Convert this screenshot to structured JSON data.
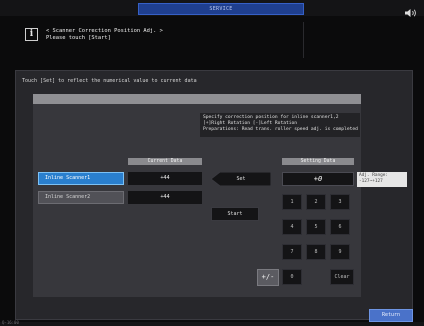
{
  "header": {
    "mode_tab": "SERVICE",
    "message_line1": "< Scanner Correction Position Adj. >",
    "message_line2": "Please touch [Start]"
  },
  "panel": {
    "instruction": "Touch [Set] to reflect the numerical value to current data",
    "description": [
      "Specify correction position for inline scanner1,2",
      "[+]Right Rotation  [-]Left Rotation",
      "Preparations: Read trans. roller speed adj. is completed"
    ],
    "current_data_header": "Current Data",
    "setting_data_header": "Setting Data",
    "scanners": [
      {
        "label": "Inline Scanner1",
        "current": "+44",
        "selected": true
      },
      {
        "label": "Inline Scanner2",
        "current": "+44",
        "selected": false
      }
    ],
    "set_label": "Set",
    "start_label": "Start",
    "setting_value": "+0",
    "range_label": "Adj. Range:",
    "range_value": "-127~+127",
    "keypad": [
      "1",
      "2",
      "3",
      "4",
      "5",
      "6",
      "7",
      "8",
      "9",
      "0",
      "Clear"
    ],
    "plus_minus_label": "+/-"
  },
  "footer": {
    "return_label": "Return",
    "corner_text": "Q-16:00"
  },
  "colors": {
    "selected_blue": "#2a7fce",
    "return_blue": "#4a72c9",
    "service_tab_blue": "#1f3f8f"
  },
  "icons": {
    "info": "info-icon",
    "speaker": "speaker-icon",
    "set_arrow": "left-arrow-icon"
  }
}
